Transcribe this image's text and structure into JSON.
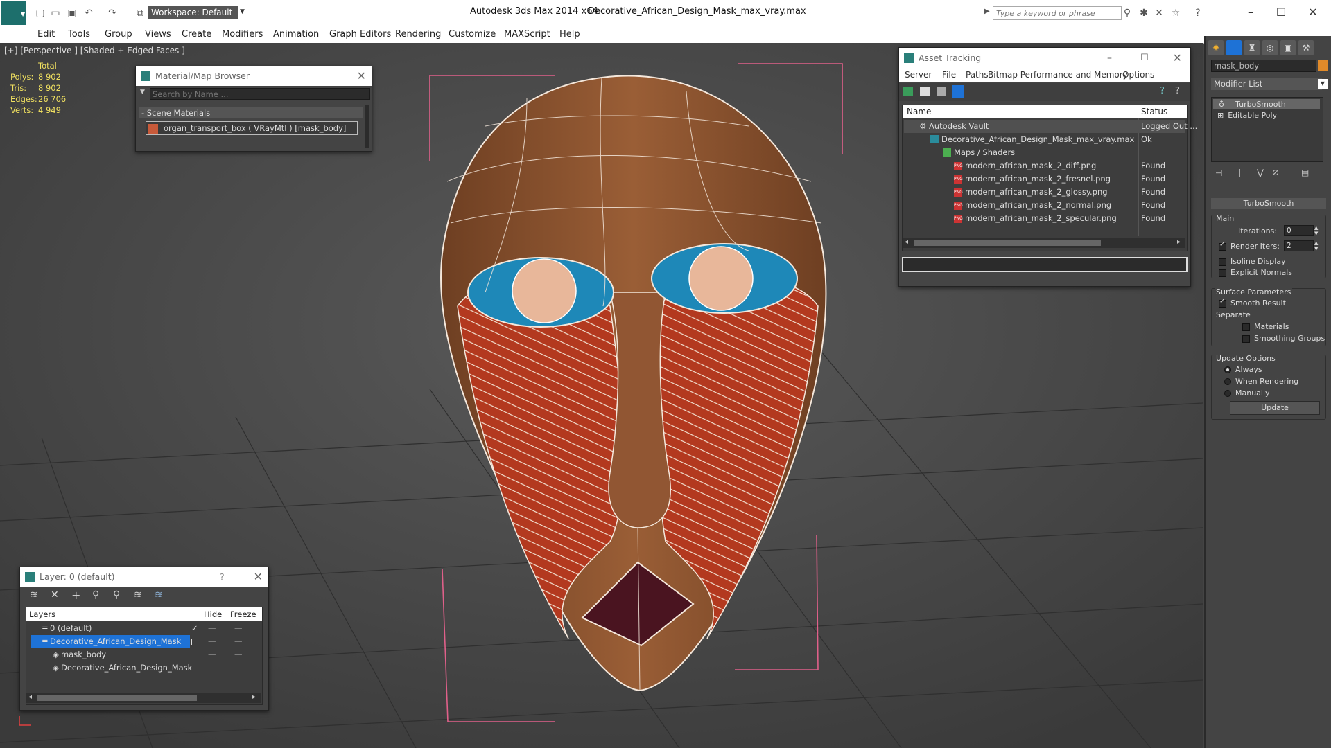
{
  "app": {
    "title": "Autodesk 3ds Max  2014 x64",
    "file": "Decorative_African_Design_Mask_max_vray.max",
    "workspace": "Workspace: Default",
    "search_placeholder": "Type a keyword or phrase"
  },
  "menu": [
    "Edit",
    "Tools",
    "Group",
    "Views",
    "Create",
    "Modifiers",
    "Animation",
    "Graph Editors",
    "Rendering",
    "Customize",
    "MAXScript",
    "Help"
  ],
  "viewport": {
    "label": "[+] [Perspective ] [Shaded + Edged Faces ]",
    "stats": {
      "header": "Total",
      "rows": [
        {
          "label": "Polys:",
          "value": "8 902"
        },
        {
          "label": "Tris:",
          "value": "8 902"
        },
        {
          "label": "Edges:",
          "value": "26 706"
        },
        {
          "label": "Verts:",
          "value": "4 949"
        }
      ]
    }
  },
  "material_browser": {
    "title": "Material/Map Browser",
    "search_placeholder": "Search by Name ...",
    "section": "- Scene Materials",
    "item": "organ_transport_box ( VRayMtl ) [mask_body]"
  },
  "asset_tracking": {
    "title": "Asset Tracking",
    "menu": [
      "Server",
      "File",
      "Paths",
      "Bitmap Performance and Memory",
      "Options"
    ],
    "columns": [
      "Name",
      "Status"
    ],
    "rows": [
      {
        "name": "Autodesk Vault",
        "status": "Logged Out ..."
      },
      {
        "name": "Decorative_African_Design_Mask_max_vray.max",
        "status": "Ok"
      },
      {
        "name": "Maps / Shaders",
        "status": ""
      },
      {
        "name": "modern_african_mask_2_diff.png",
        "status": "Found"
      },
      {
        "name": "modern_african_mask_2_fresnel.png",
        "status": "Found"
      },
      {
        "name": "modern_african_mask_2_glossy.png",
        "status": "Found"
      },
      {
        "name": "modern_african_mask_2_normal.png",
        "status": "Found"
      },
      {
        "name": "modern_african_mask_2_specular.png",
        "status": "Found"
      }
    ],
    "png_badge": "PNG"
  },
  "layer_panel": {
    "title": "Layer: 0 (default)",
    "help": "?",
    "columns": [
      "Layers",
      "Hide",
      "Freeze"
    ],
    "rows": [
      {
        "name": "0 (default)"
      },
      {
        "name": "Decorative_African_Design_Mask"
      },
      {
        "name": "mask_body"
      },
      {
        "name": "Decorative_African_Design_Mask"
      }
    ]
  },
  "command_panel": {
    "object_name": "mask_body",
    "modifier_list": "Modifier List",
    "stack": [
      "TurboSmooth",
      "Editable Poly"
    ],
    "turbosmooth": {
      "title": "TurboSmooth",
      "main": "Main",
      "iterations_label": "Iterations:",
      "iterations": "0",
      "render_iters_label": "Render Iters:",
      "render_iters": "2",
      "isoline": "Isoline Display",
      "explicit_normals": "Explicit Normals",
      "surface_params": "Surface Parameters",
      "smooth_result": "Smooth Result",
      "separate": "Separate",
      "materials": "Materials",
      "smoothing_groups": "Smoothing Groups",
      "update_options": "Update Options",
      "always": "Always",
      "when_rendering": "When Rendering",
      "manually": "Manually",
      "update_button": "Update"
    }
  },
  "colors": {
    "wood": "#8a5230",
    "red_pattern": "#b3391f",
    "eye_blue": "#1e88b8",
    "selection_blue": "#1e72d6",
    "accent_orange": "#e08a2a"
  }
}
